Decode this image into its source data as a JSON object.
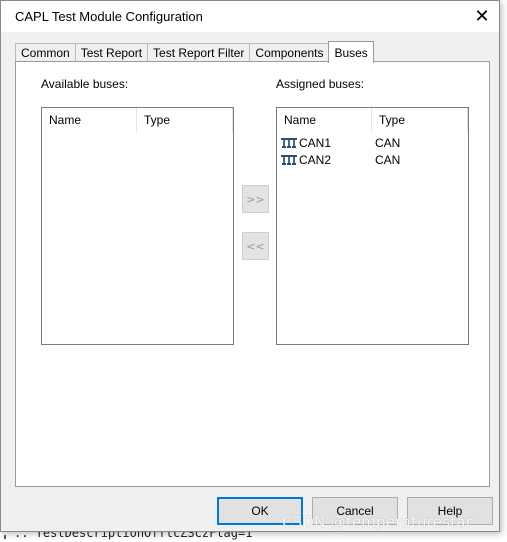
{
  "background": {
    "code_line": "..  TestDescriptionOfflcZSczFlag=1"
  },
  "dialog": {
    "title": "CAPL Test Module Configuration",
    "close_glyph": "✕",
    "tabs": [
      {
        "label": "Common",
        "active": false
      },
      {
        "label": "Test Report",
        "active": false
      },
      {
        "label": "Test Report Filter",
        "active": false
      },
      {
        "label": "Components",
        "active": false
      },
      {
        "label": "Buses",
        "active": true
      }
    ],
    "available": {
      "label": "Available buses:",
      "columns": [
        "Name",
        "Type"
      ],
      "rows": []
    },
    "assigned": {
      "label": "Assigned buses:",
      "columns": [
        "Name",
        "Type"
      ],
      "rows": [
        {
          "name": "CAN1",
          "type": "CAN",
          "icon": "bus-network-icon"
        },
        {
          "name": "CAN2",
          "type": "CAN",
          "icon": "bus-network-icon"
        }
      ]
    },
    "move_right_label": ">>",
    "move_left_label": "<<",
    "buttons": {
      "ok": "OK",
      "cancel": "Cancel",
      "help": "Help"
    },
    "watermark": "CSDN @temperaturestar"
  }
}
